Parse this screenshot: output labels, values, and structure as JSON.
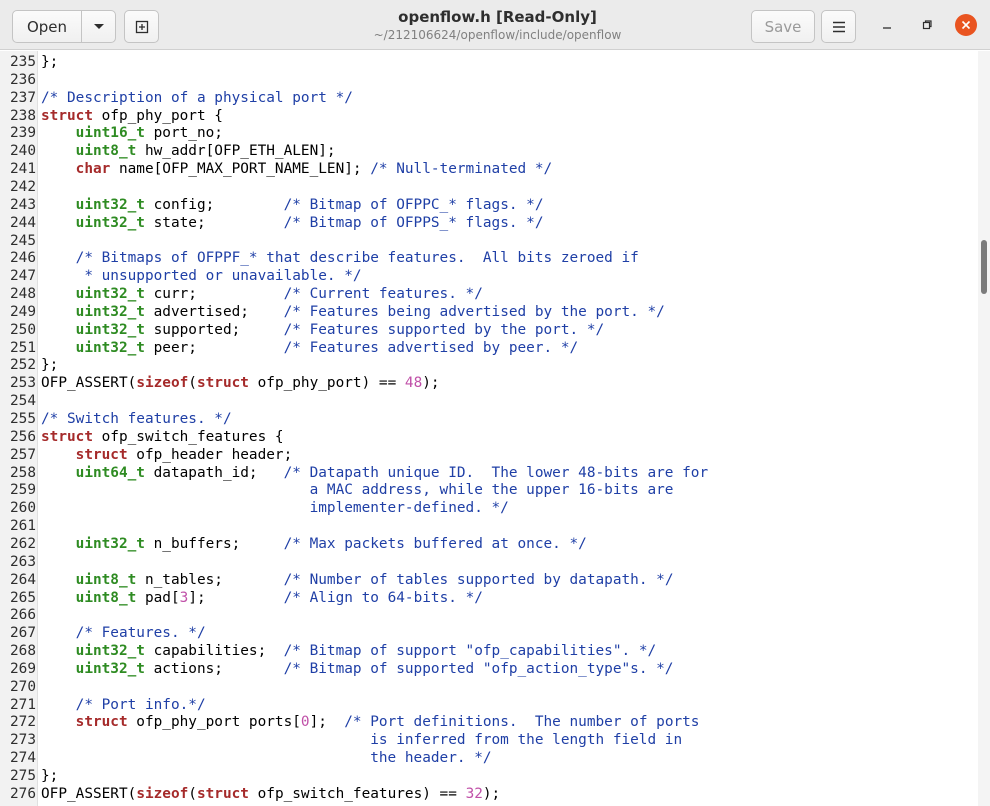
{
  "header": {
    "open_label": "Open",
    "title": "openflow.h [Read-Only]",
    "subtitle": "~/212106624/openflow/include/openflow",
    "save_label": "Save",
    "icons": [
      "chevron-down-icon",
      "new-tab-icon",
      "hamburger-menu-icon",
      "minimize-icon",
      "maximize-icon",
      "close-icon"
    ],
    "close_color": "#e95420"
  },
  "syntax_colors": {
    "comment": "#1f3fa6",
    "keyword": "#a52a2a",
    "type": "#2e8b22",
    "number": "#c050a8"
  },
  "editor": {
    "lines": [
      {
        "n": "235",
        "t": "};"
      },
      {
        "n": "236",
        "t": ""
      },
      {
        "n": "237",
        "t": "/* Description of a physical port */"
      },
      {
        "n": "238",
        "t": "struct ofp_phy_port {"
      },
      {
        "n": "239",
        "t": "    uint16_t port_no;"
      },
      {
        "n": "240",
        "t": "    uint8_t hw_addr[OFP_ETH_ALEN];"
      },
      {
        "n": "241",
        "t": "    char name[OFP_MAX_PORT_NAME_LEN]; /* Null-terminated */"
      },
      {
        "n": "242",
        "t": ""
      },
      {
        "n": "243",
        "t": "    uint32_t config;        /* Bitmap of OFPPC_* flags. */"
      },
      {
        "n": "244",
        "t": "    uint32_t state;         /* Bitmap of OFPPS_* flags. */"
      },
      {
        "n": "245",
        "t": ""
      },
      {
        "n": "246",
        "t": "    /* Bitmaps of OFPPF_* that describe features.  All bits zeroed if"
      },
      {
        "n": "247",
        "t": "     * unsupported or unavailable. */"
      },
      {
        "n": "248",
        "t": "    uint32_t curr;          /* Current features. */"
      },
      {
        "n": "249",
        "t": "    uint32_t advertised;    /* Features being advertised by the port. */"
      },
      {
        "n": "250",
        "t": "    uint32_t supported;     /* Features supported by the port. */"
      },
      {
        "n": "251",
        "t": "    uint32_t peer;          /* Features advertised by peer. */"
      },
      {
        "n": "252",
        "t": "};"
      },
      {
        "n": "253",
        "t": "OFP_ASSERT(sizeof(struct ofp_phy_port) == 48);"
      },
      {
        "n": "254",
        "t": ""
      },
      {
        "n": "255",
        "t": "/* Switch features. */"
      },
      {
        "n": "256",
        "t": "struct ofp_switch_features {"
      },
      {
        "n": "257",
        "t": "    struct ofp_header header;"
      },
      {
        "n": "258",
        "t": "    uint64_t datapath_id;   /* Datapath unique ID.  The lower 48-bits are for"
      },
      {
        "n": "259",
        "t": "                               a MAC address, while the upper 16-bits are"
      },
      {
        "n": "260",
        "t": "                               implementer-defined. */"
      },
      {
        "n": "261",
        "t": ""
      },
      {
        "n": "262",
        "t": "    uint32_t n_buffers;     /* Max packets buffered at once. */"
      },
      {
        "n": "263",
        "t": ""
      },
      {
        "n": "264",
        "t": "    uint8_t n_tables;       /* Number of tables supported by datapath. */"
      },
      {
        "n": "265",
        "t": "    uint8_t pad[3];         /* Align to 64-bits. */"
      },
      {
        "n": "266",
        "t": ""
      },
      {
        "n": "267",
        "t": "    /* Features. */"
      },
      {
        "n": "268",
        "t": "    uint32_t capabilities;  /* Bitmap of support \"ofp_capabilities\". */"
      },
      {
        "n": "269",
        "t": "    uint32_t actions;       /* Bitmap of supported \"ofp_action_type\"s. */"
      },
      {
        "n": "270",
        "t": ""
      },
      {
        "n": "271",
        "t": "    /* Port info.*/"
      },
      {
        "n": "272",
        "t": "    struct ofp_phy_port ports[0];  /* Port definitions.  The number of ports"
      },
      {
        "n": "273",
        "t": "                                      is inferred from the length field in"
      },
      {
        "n": "274",
        "t": "                                      the header. */"
      },
      {
        "n": "275",
        "t": "};"
      },
      {
        "n": "276",
        "t": "OFP_ASSERT(sizeof(struct ofp_switch_features) == 32);"
      }
    ]
  }
}
